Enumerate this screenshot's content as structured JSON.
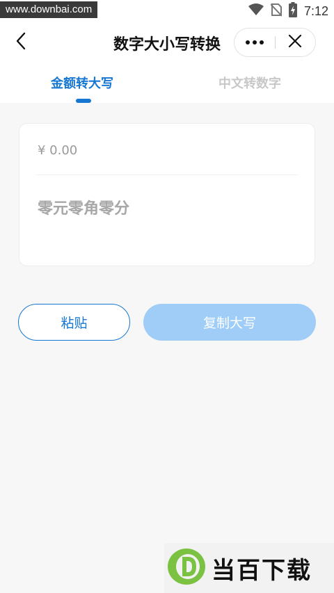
{
  "status_bar": {
    "watermark_url": "www.downbai.com",
    "time": "7:12",
    "icons": [
      "wifi-icon",
      "no-sim-icon",
      "battery-charging-icon"
    ]
  },
  "nav": {
    "title": "数字大小写转换",
    "back_icon": "chevron-left-icon",
    "more_icon": "more-dots-icon",
    "close_icon": "close-icon"
  },
  "tabs": [
    {
      "label": "金额转大写",
      "active": true
    },
    {
      "label": "中文转数字",
      "active": false
    }
  ],
  "converter": {
    "input_value": "",
    "input_placeholder": "¥ 0.00",
    "result": "零元零角零分"
  },
  "actions": {
    "paste_label": "粘贴",
    "copy_label": "复制大写"
  },
  "watermark": {
    "logo_letter": "D",
    "logo_text": "当百下载"
  },
  "colors": {
    "accent": "#1677d2",
    "accent_disabled": "#9fcdf7",
    "background": "#f7f7f7"
  }
}
